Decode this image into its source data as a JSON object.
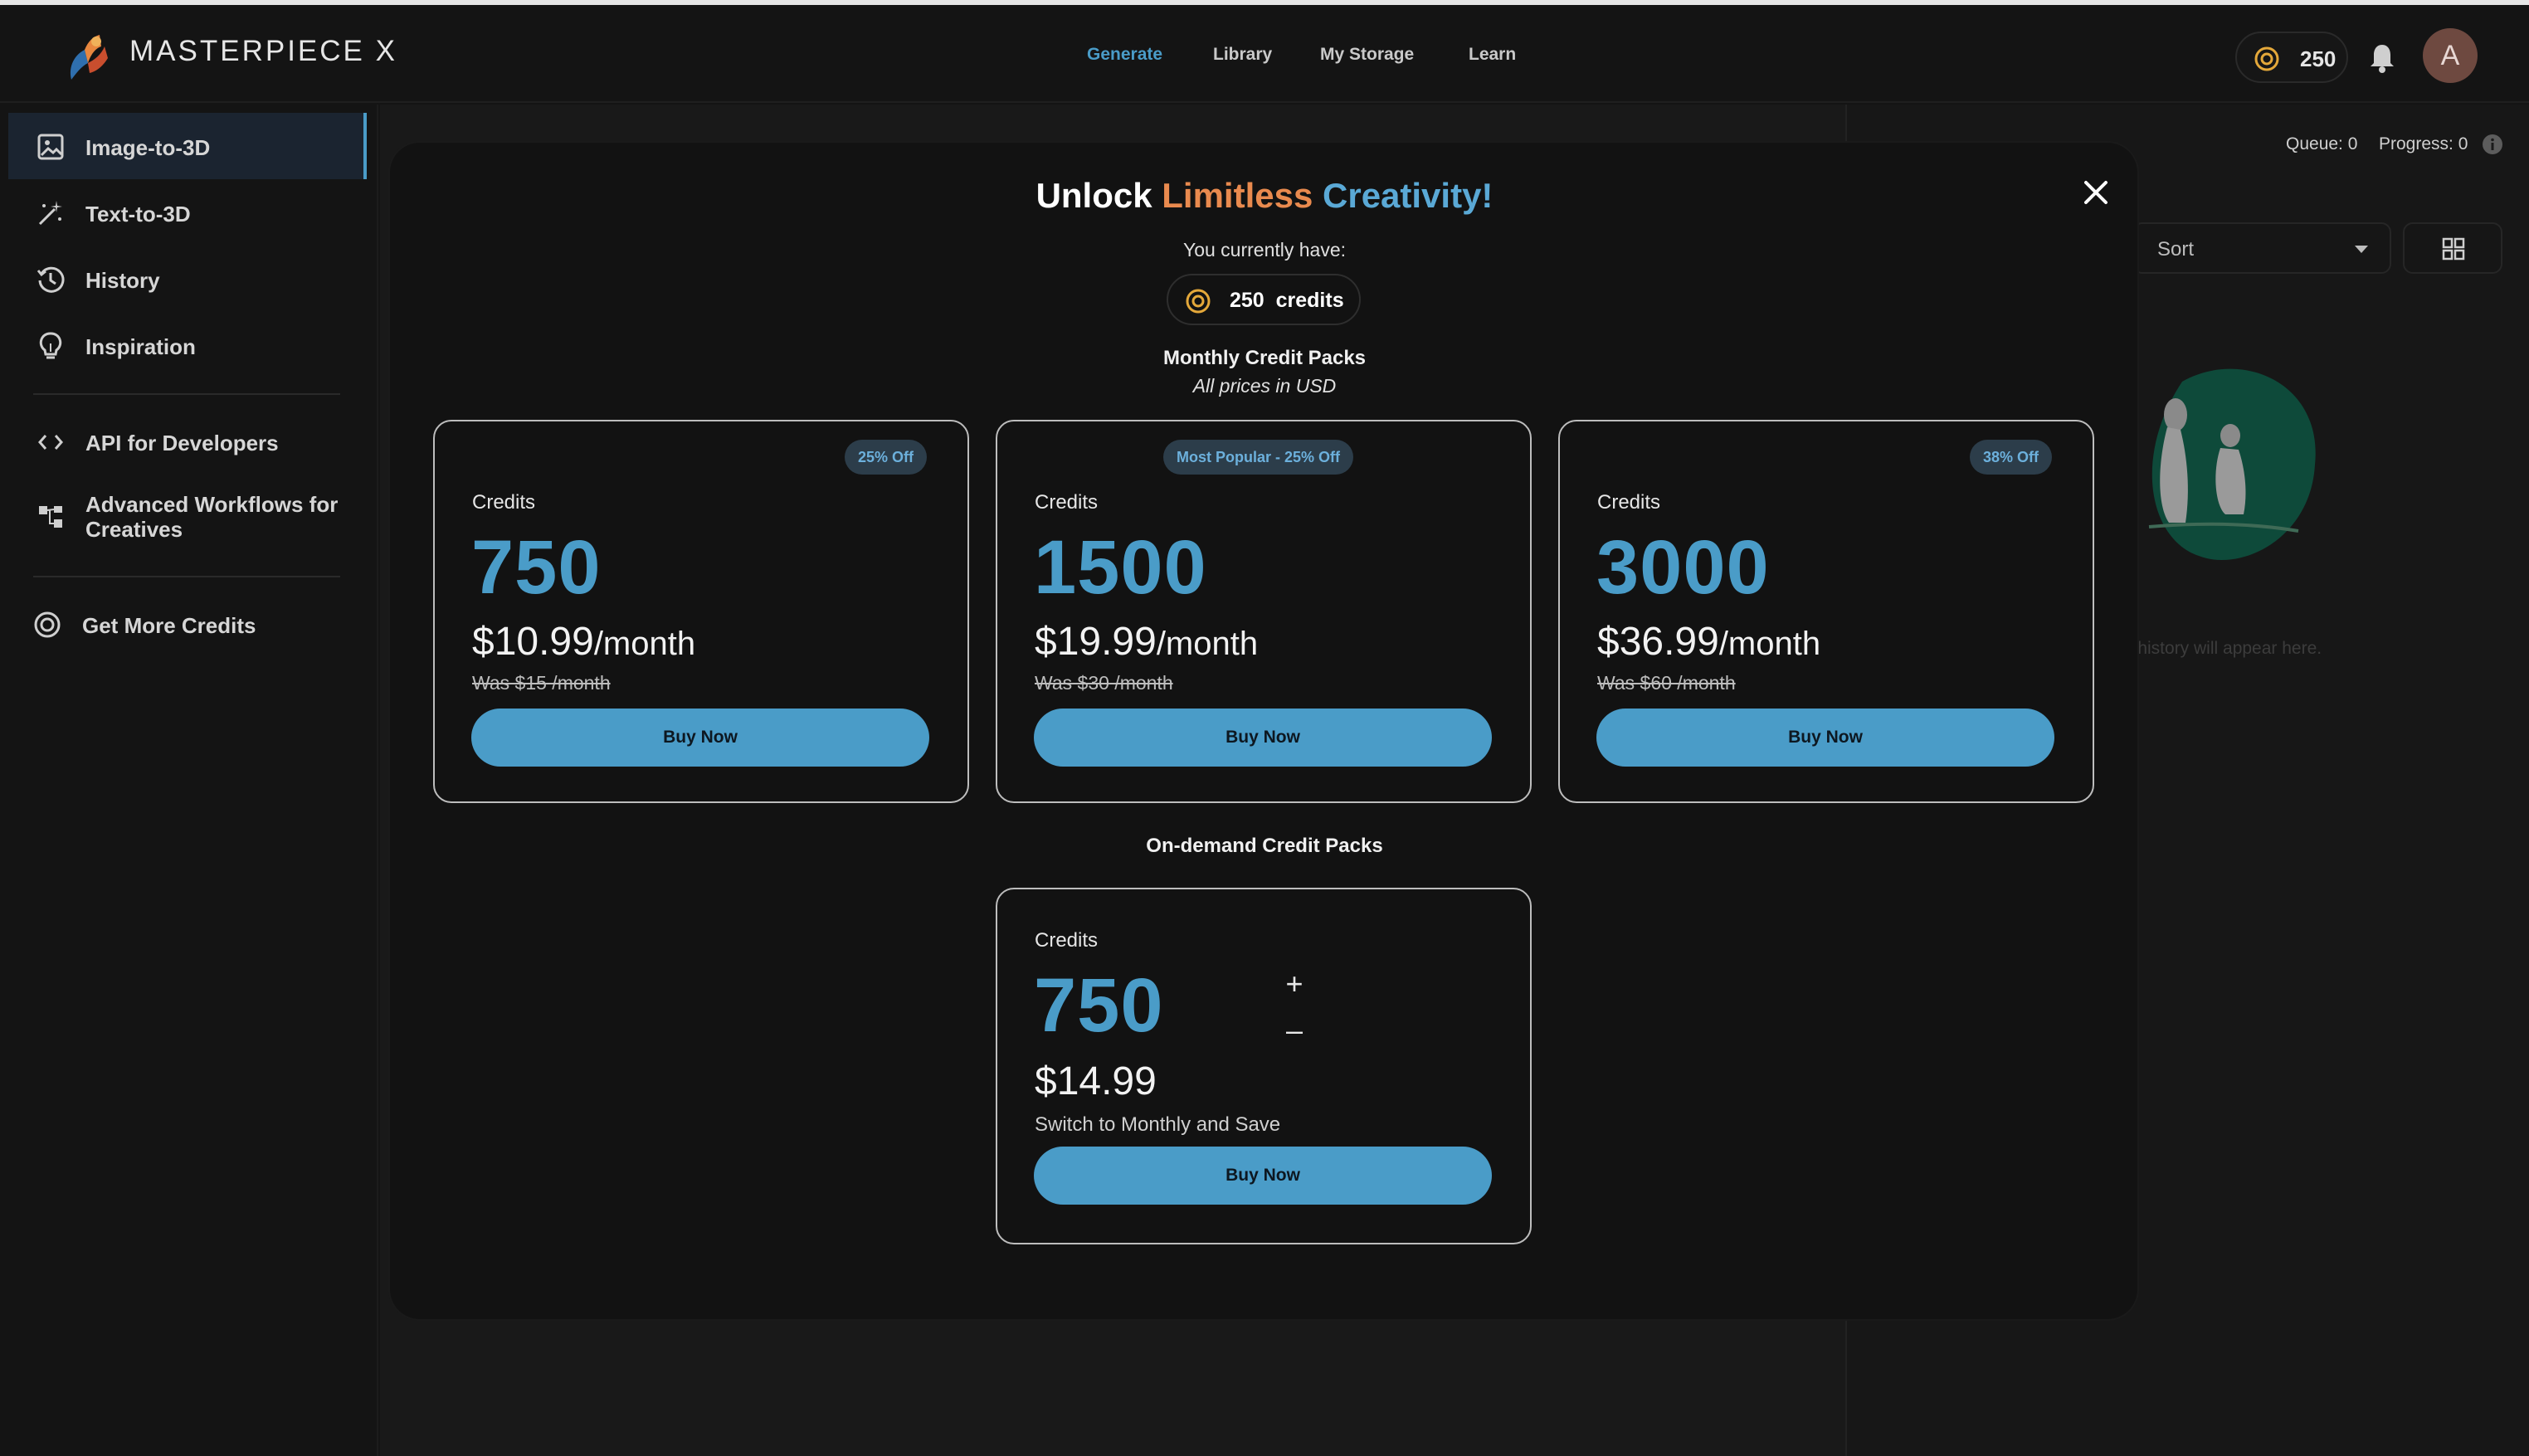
{
  "app": {
    "brand": "MASTERPIECE X",
    "credits": "250",
    "avatar_initial": "A",
    "accent_color": "#4a9cc8"
  },
  "nav": {
    "generate": "Generate",
    "library": "Library",
    "storage": "My Storage",
    "learn": "Learn"
  },
  "sidebar": {
    "items": [
      {
        "label": "Image-to-3D",
        "icon": "image-icon"
      },
      {
        "label": "Text-to-3D",
        "icon": "magic-wand-icon"
      },
      {
        "label": "History",
        "icon": "history-icon"
      },
      {
        "label": "Inspiration",
        "icon": "lightbulb-icon"
      },
      {
        "label": "API for Developers",
        "icon": "code-icon"
      },
      {
        "label": "Advanced Workflows for",
        "label2": "Creatives",
        "icon": "workflow-icon"
      },
      {
        "label": "Get More Credits",
        "icon": "coin-icon"
      }
    ]
  },
  "right_panel": {
    "queue": "Queue: 0",
    "progress": "Progress: 0",
    "sort": "Sort",
    "empty_hint": "y history will appear here."
  },
  "modal": {
    "title_1": "Unlock ",
    "title_2": "Limitless",
    "title_3": " Creativity!",
    "have_text": "You currently have:",
    "have_credits": "250",
    "have_credits_word": "credits",
    "monthly_title": "Monthly Credit Packs",
    "monthly_sub": "All prices in USD",
    "ondemand_title": "On-demand Credit Packs",
    "monthly_packs": [
      {
        "badge": "25% Off",
        "label": "Credits",
        "credits": "750",
        "price": "$10.99",
        "per": "/month",
        "was": "Was $15 /month",
        "button": "Buy Now"
      },
      {
        "badge": "Most Popular - 25% Off",
        "label": "Credits",
        "credits": "1500",
        "price": "$19.99",
        "per": "/month",
        "was": "Was $30 /month",
        "button": "Buy Now"
      },
      {
        "badge": "38% Off",
        "label": "Credits",
        "credits": "3000",
        "price": "$36.99",
        "per": "/month",
        "was": "Was $60 /month",
        "button": "Buy Now"
      }
    ],
    "ondemand_pack": {
      "label": "Credits",
      "credits": "750",
      "price": "$14.99",
      "note": "Switch to Monthly and Save",
      "button": "Buy Now",
      "plus": "+",
      "minus": "–"
    }
  }
}
